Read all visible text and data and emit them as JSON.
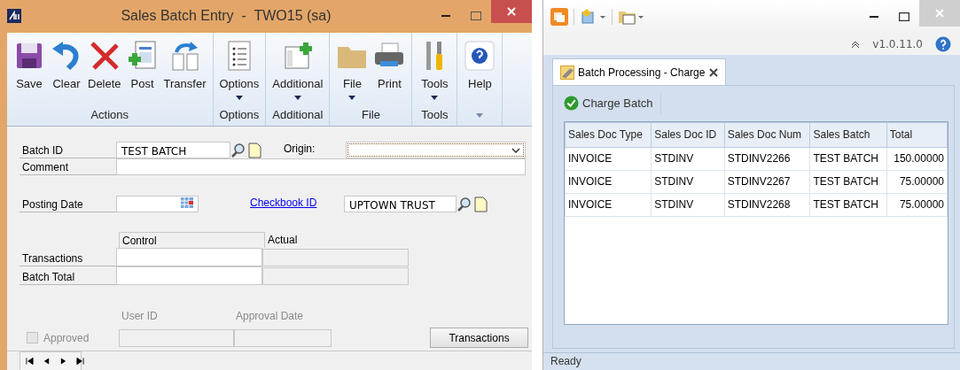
{
  "sales_window": {
    "title": "Sales Batch Entry  -  TWO15 (sa)",
    "ribbon_groups": [
      {
        "label": "Actions",
        "buttons": [
          {
            "label": "Save",
            "kind": "save",
            "dropdown": false
          },
          {
            "label": "Clear",
            "kind": "clear",
            "dropdown": false
          },
          {
            "label": "Delete",
            "kind": "delete",
            "dropdown": false
          },
          {
            "label": "Post",
            "kind": "post",
            "dropdown": false
          },
          {
            "label": "Transfer",
            "kind": "transfer",
            "dropdown": false
          }
        ]
      },
      {
        "label": "Options",
        "buttons": [
          {
            "label": "Options",
            "kind": "options",
            "dropdown": true
          }
        ]
      },
      {
        "label": "Additional",
        "buttons": [
          {
            "label": "Additional",
            "kind": "additional",
            "dropdown": true
          }
        ]
      },
      {
        "label": "File",
        "buttons": [
          {
            "label": "File",
            "kind": "file",
            "dropdown": true
          },
          {
            "label": "Print",
            "kind": "print",
            "dropdown": false
          }
        ]
      },
      {
        "label": "Tools",
        "buttons": [
          {
            "label": "Tools",
            "kind": "tools",
            "dropdown": true
          }
        ]
      },
      {
        "buttons": [
          {
            "label": "Help",
            "kind": "help",
            "dropdown": false
          }
        ]
      }
    ],
    "form": {
      "batch_id_label": "Batch ID",
      "batch_id": "TEST BATCH",
      "origin_label": "Origin:",
      "comment_label": "Comment",
      "posting_date_label": "Posting Date",
      "checkbook_link": "Checkbook ID",
      "checkbook_id": "UPTOWN TRUST",
      "totals_columns": [
        "Control",
        "Actual"
      ],
      "totals_rows": [
        "Transactions",
        "Batch Total"
      ],
      "user_id_label": "User ID",
      "approval_date_label": "Approval Date",
      "approved": {
        "label": "Approved",
        "checked": false,
        "disabled": true
      },
      "transactions_button": "Transactions"
    }
  },
  "charge_window": {
    "version": "v1.0.11.0",
    "tabs": [
      {
        "label": "Batch Processing - Charge",
        "selected": true
      }
    ],
    "toolbar_button": "Charge Batch",
    "table": {
      "columns": [
        "Sales Doc Type",
        "Sales Doc ID",
        "Sales Doc Num",
        "Sales Batch",
        "Total"
      ],
      "rows": [
        [
          "INVOICE",
          "STDINV",
          "STDINV2266",
          "TEST BATCH",
          "150.00000"
        ],
        [
          "INVOICE",
          "STDINV",
          "STDINV2267",
          "TEST BATCH",
          "75.00000"
        ],
        [
          "INVOICE",
          "STDINV",
          "STDINV2268",
          "TEST BATCH",
          "75.00000"
        ]
      ]
    },
    "status_bar": "Ready"
  }
}
